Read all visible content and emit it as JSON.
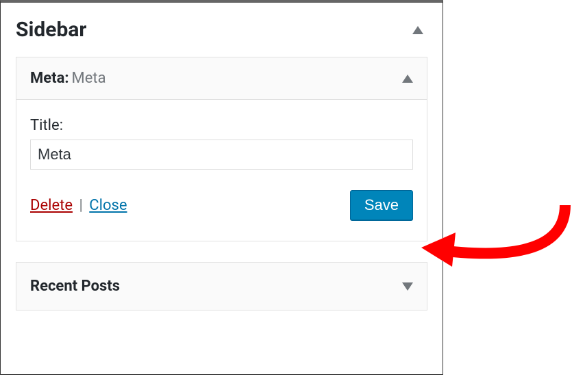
{
  "sidebar": {
    "title": "Sidebar"
  },
  "widget": {
    "name": "Meta",
    "subtitle": "Meta",
    "field_label": "Title:",
    "field_value": "Meta",
    "delete_label": "Delete",
    "separator": " | ",
    "close_label": "Close",
    "save_label": "Save"
  },
  "collapsed_widget": {
    "title": "Recent Posts"
  }
}
